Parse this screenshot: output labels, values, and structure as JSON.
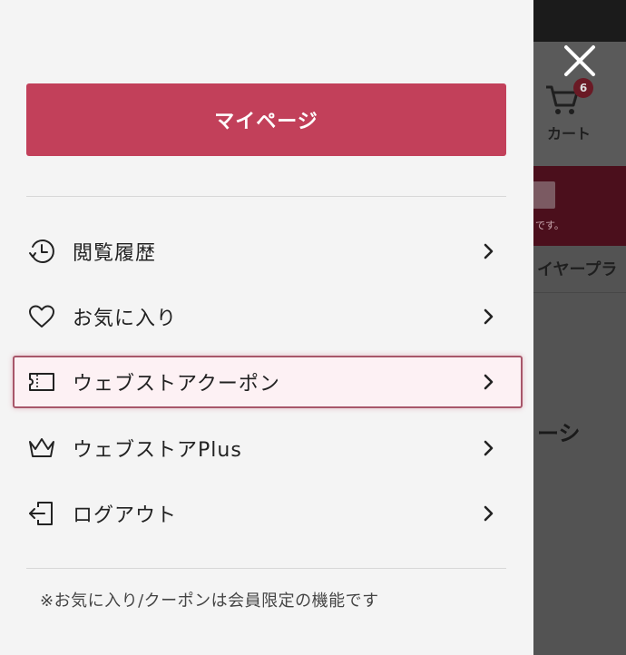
{
  "background": {
    "cart_label": "カート",
    "cart_count": "6",
    "banner_text": "です。",
    "tab_text": "イヤープラ",
    "heading_text": "ーシ"
  },
  "drawer": {
    "mypage_label": "マイページ",
    "menu": [
      {
        "label": "閲覧履歴",
        "icon": "history-clock-icon"
      },
      {
        "label": "お気に入り",
        "icon": "heart-icon"
      },
      {
        "label": "ウェブストアクーポン",
        "icon": "coupon-ticket-icon",
        "active": true
      },
      {
        "label": "ウェブストアPlus",
        "icon": "crown-icon"
      },
      {
        "label": "ログアウト",
        "icon": "logout-icon"
      }
    ],
    "footnote": "※お気に入り/クーポンは会員限定の機能です"
  },
  "colors": {
    "accent": "#c2405a",
    "drawer_bg": "#f4f4f4",
    "overlay": "#535353",
    "active_border": "#a8576a"
  }
}
